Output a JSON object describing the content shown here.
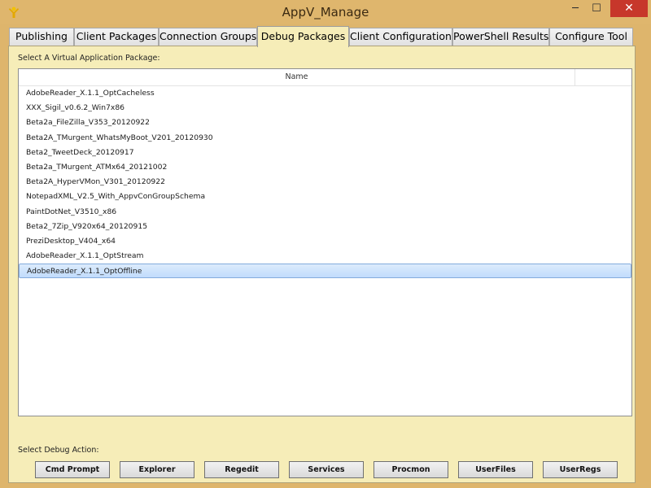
{
  "window": {
    "title": "AppV_Manage",
    "minimize_glyph": "─",
    "maximize_glyph": "☐",
    "close_glyph": "✕"
  },
  "tabs": [
    {
      "label": "Publishing"
    },
    {
      "label": "Client Packages"
    },
    {
      "label": "Connection Groups"
    },
    {
      "label": "Debug Packages",
      "active": true
    },
    {
      "label": "Client Configuration"
    },
    {
      "label": "PowerShell Results"
    },
    {
      "label": "Configure Tool"
    }
  ],
  "debug_panel": {
    "select_label": "Select A Virtual Application Package:",
    "list_header": "Name",
    "packages": [
      "AdobeReader_X.1.1_OptCacheless",
      "XXX_Sigil_v0.6.2_Win7x86",
      "Beta2a_FileZilla_V353_20120922",
      "Beta2A_TMurgent_WhatsMyBoot_V201_20120930",
      "Beta2_TweetDeck_20120917",
      "Beta2a_TMurgent_ATMx64_20121002",
      "Beta2A_HyperVMon_V301_20120922",
      "NotepadXML_V2.5_With_AppvConGroupSchema",
      "PaintDotNet_V3510_x86",
      "Beta2_7Zip_V920x64_20120915",
      "PreziDesktop_V404_x64",
      "AdobeReader_X.1.1_OptStream",
      "AdobeReader_X.1.1_OptOffline"
    ],
    "selected_index": 12,
    "action_label": "Select Debug Action:",
    "actions": [
      "Cmd Prompt",
      "Explorer",
      "Regedit",
      "Services",
      "Procmon",
      "UserFiles",
      "UserRegs"
    ]
  },
  "colors": {
    "window_bg": "#deb56c",
    "panel_bg": "#f6edb8",
    "close_button": "#c7372b",
    "selection": "#cfe4fc"
  }
}
